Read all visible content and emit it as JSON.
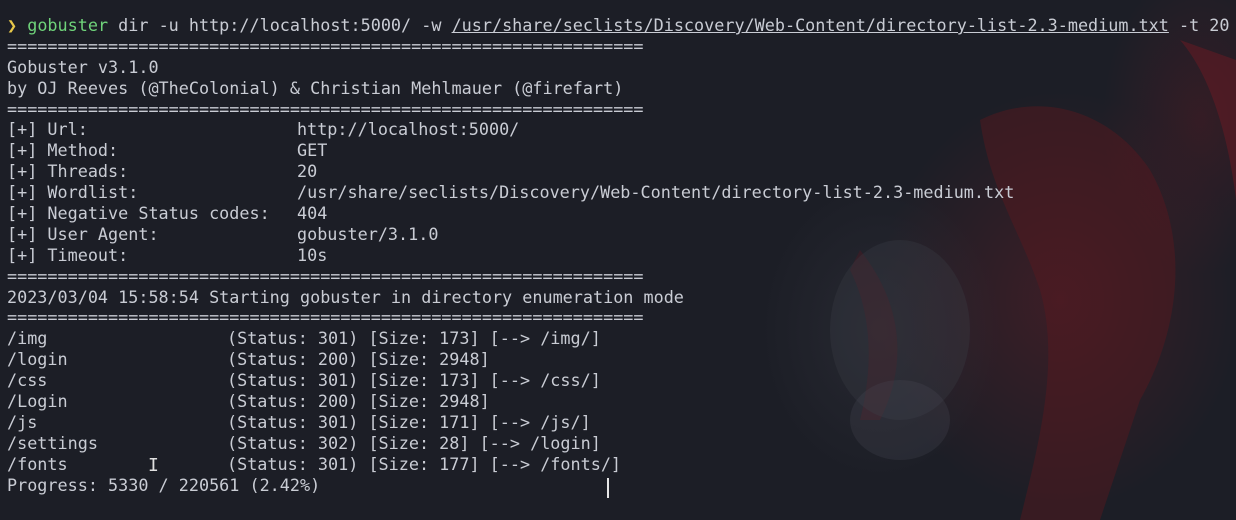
{
  "prompt": {
    "arrow": "❯",
    "command": "gobuster",
    "args_before": " dir -u http://localhost:5000/ -w ",
    "wordlist_path": "/usr/share/seclists/Discovery/Web-Content/directory-list-2.3-medium.txt",
    "args_after": " -t 20"
  },
  "separator": "===============================================================",
  "banner": {
    "version": "Gobuster v3.1.0",
    "authors": "by OJ Reeves (@TheColonial) & Christian Mehlmauer (@firefart)"
  },
  "config": [
    {
      "key": "[+] Url:",
      "value": "http://localhost:5000/"
    },
    {
      "key": "[+] Method:",
      "value": "GET"
    },
    {
      "key": "[+] Threads:",
      "value": "20"
    },
    {
      "key": "[+] Wordlist:",
      "value": "/usr/share/seclists/Discovery/Web-Content/directory-list-2.3-medium.txt"
    },
    {
      "key": "[+] Negative Status codes:",
      "value": "404"
    },
    {
      "key": "[+] User Agent:",
      "value": "gobuster/3.1.0"
    },
    {
      "key": "[+] Timeout:",
      "value": "10s"
    }
  ],
  "start_message": "2023/03/04 15:58:54 Starting gobuster in directory enumeration mode",
  "results": [
    {
      "path": "/img",
      "info": "(Status: 301) [Size: 173] [--> /img/]"
    },
    {
      "path": "/login",
      "info": "(Status: 200) [Size: 2948]"
    },
    {
      "path": "/css",
      "info": "(Status: 301) [Size: 173] [--> /css/]"
    },
    {
      "path": "/Login",
      "info": "(Status: 200) [Size: 2948]"
    },
    {
      "path": "/js",
      "info": "(Status: 301) [Size: 171] [--> /js/]"
    },
    {
      "path": "/settings",
      "info": "(Status: 302) [Size: 28] [--> /login]"
    },
    {
      "path": "/fonts",
      "info": "(Status: 301) [Size: 177] [--> /fonts/]"
    }
  ],
  "progress": "Progress: 5330 / 220561 (2.42%)",
  "mouse_ibeam": "I",
  "colors": {
    "background": "#1c1e26",
    "text": "#c9ccd4",
    "prompt_arrow": "#e8c84a",
    "command": "#6fd37a",
    "art_red": "#7a1e28"
  }
}
